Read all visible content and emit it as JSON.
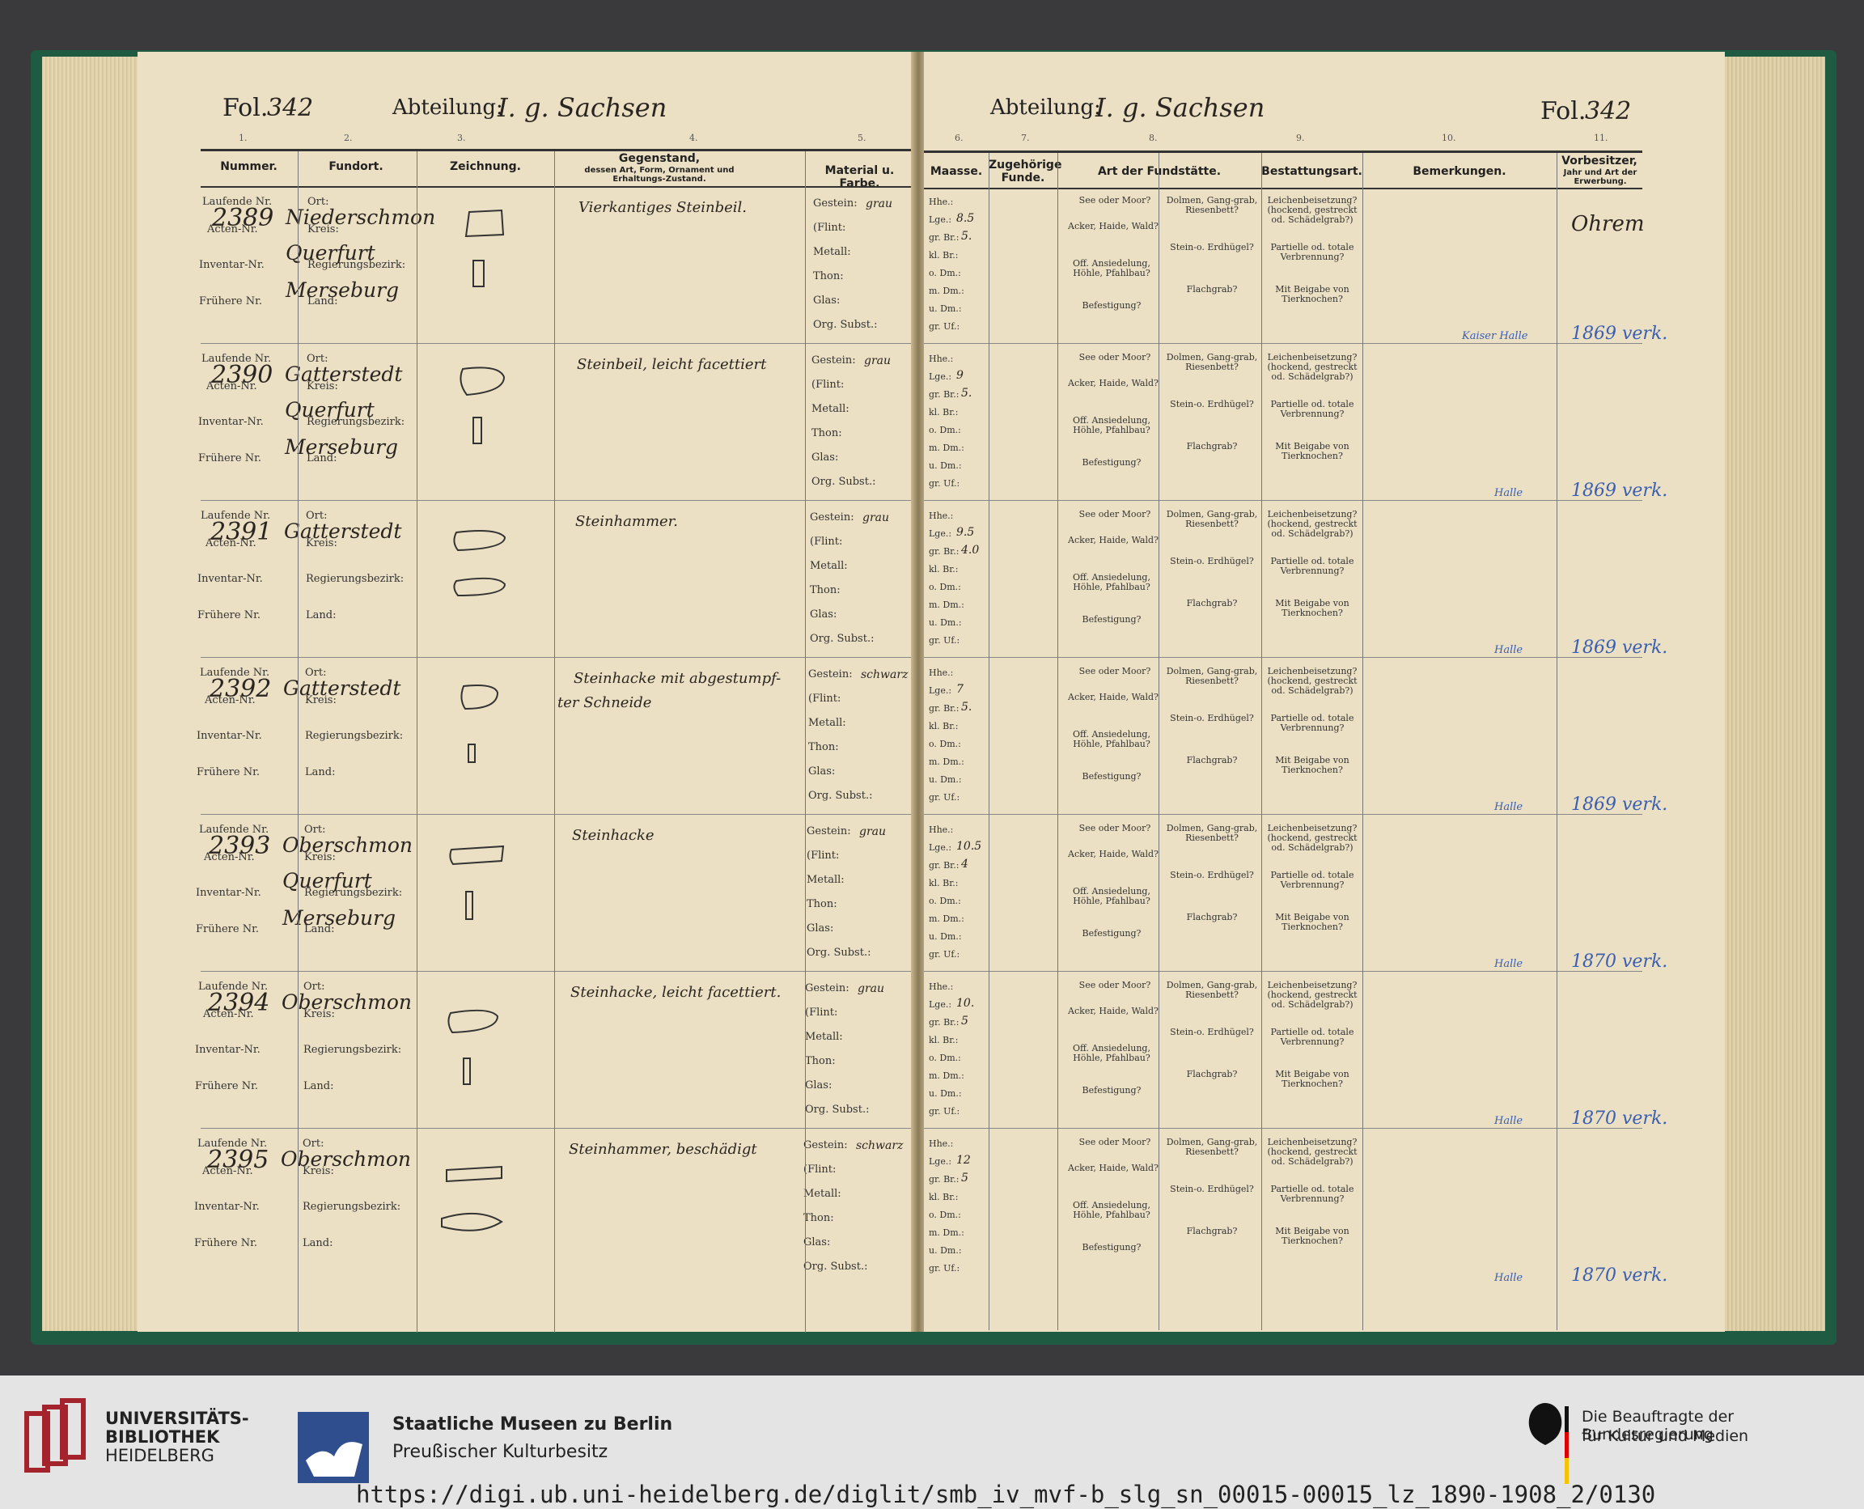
{
  "left": {
    "folio_label": "Fol.",
    "folio_num": "342",
    "abteilung_label": "Abteilung:",
    "abteilung_value": "I. g. Sachsen",
    "colnums": [
      "1.",
      "2.",
      "3.",
      "4.",
      "5."
    ],
    "headers": {
      "nummer": "Nummer.",
      "fundort": "Fundort.",
      "zeichnung": "Zeichnung.",
      "gegenstand": "Gegenstand,",
      "gegenstand_sub": "dessen Art, Form, Ornament und Erhaltungs-Zustand.",
      "material": "Material u. Farbe."
    },
    "labels": {
      "laufende": "Laufende Nr.",
      "acten": "Acten-Nr.",
      "inventar": "Inventar-Nr.",
      "fruehere": "Frühere Nr.",
      "ort": "Ort:",
      "kreis": "Kreis:",
      "bezirk": "Regierungsbezirk:",
      "land": "Land:",
      "gestein": "Gestein:",
      "flint": "(Flint:",
      "metall": "Metall:",
      "thon": "Thon:",
      "glas": "Glas:",
      "org": "Org. Subst.:"
    }
  },
  "right": {
    "abteilung_label": "Abteilung:",
    "abteilung_value": "I. g. Sachsen",
    "folio_label": "Fol.",
    "folio_num": "342",
    "colnums": [
      "6.",
      "7.",
      "8.",
      "9.",
      "10.",
      "11."
    ],
    "headers": {
      "maasse": "Maasse.",
      "zugehoerige": "Zugehörige Funde.",
      "art": "Art der Fundstätte.",
      "bestattung": "Bestattungsart.",
      "bemerkungen": "Bemerkungen.",
      "vorbesitzer": "Vorbesitzer,",
      "vorbesitzer_sub": "Jahr und Art der Erwerbung."
    },
    "maasse_labels": [
      "Hhe.:",
      "Lge.:",
      "gr. Br.:",
      "kl. Br.:",
      "o. Dm.:",
      "m. Dm.:",
      "u. Dm.:",
      "gr. Uf.:"
    ],
    "fund_texts": [
      "See oder Moor?",
      "Acker, Haide, Wald?",
      "Off. Ansiedelung, Höhle, Pfahlbau?",
      "Befestigung?",
      "Dolmen, Gang-grab, Riesenbett?",
      "Stein-o. Erdhügel?",
      "Flachgrab?"
    ],
    "best_texts": [
      "Leichenbeisetzung? (hockend, gestreckt od. Schädelgrab?)",
      "Partielle od. totale Verbrennung?",
      "Mit Beigabe von Tierknochen?"
    ]
  },
  "rows": [
    {
      "num": "2389",
      "ort": "Niederschmon",
      "kreis": "Querfurt",
      "bezirk": "Merseburg",
      "desc": "Vierkantiges Steinbeil.",
      "desc2": "",
      "gestein": "grau",
      "hhe": "",
      "lge": "8.5",
      "grbr": "5.",
      "vorbesitzer": "Ohrem",
      "bem": "Kaiser Halle",
      "year": "1869 verk."
    },
    {
      "num": "2390",
      "ort": "Gatterstedt",
      "kreis": "Querfurt",
      "bezirk": "Merseburg",
      "desc": "Steinbeil, leicht facettiert",
      "desc2": "",
      "gestein": "grau",
      "hhe": "",
      "lge": "9",
      "grbr": "5.",
      "vorbesitzer": "",
      "bem": "Halle",
      "year": "1869 verk."
    },
    {
      "num": "2391",
      "ort": "Gatterstedt",
      "kreis": "",
      "bezirk": "",
      "desc": "Steinhammer.",
      "desc2": "",
      "gestein": "grau",
      "hhe": "",
      "lge": "9.5",
      "grbr": "4.0",
      "vorbesitzer": "",
      "bem": "Halle",
      "year": "1869 verk."
    },
    {
      "num": "2392",
      "ort": "Gatterstedt",
      "kreis": "",
      "bezirk": "",
      "desc": "Steinhacke mit abgestumpf-",
      "desc2": "ter Schneide",
      "gestein": "schwarz",
      "hhe": "",
      "lge": "7",
      "grbr": "5.",
      "vorbesitzer": "",
      "bem": "Halle",
      "year": "1869 verk."
    },
    {
      "num": "2393",
      "ort": "Oberschmon",
      "kreis": "Querfurt",
      "bezirk": "Merseburg",
      "desc": "Steinhacke",
      "desc2": "",
      "gestein": "grau",
      "hhe": "",
      "lge": "10.5",
      "grbr": "4",
      "vorbesitzer": "",
      "bem": "Halle",
      "year": "1870 verk."
    },
    {
      "num": "2394",
      "ort": "Oberschmon",
      "kreis": "",
      "bezirk": "",
      "desc": "Steinhacke, leicht facettiert.",
      "desc2": "",
      "gestein": "grau",
      "hhe": "",
      "lge": "10.",
      "grbr": "5",
      "vorbesitzer": "",
      "bem": "Halle",
      "year": "1870 verk."
    },
    {
      "num": "2395",
      "ort": "Oberschmon",
      "kreis": "",
      "bezirk": "",
      "desc": "Steinhammer, beschädigt",
      "desc2": "",
      "gestein": "schwarz",
      "hhe": "",
      "lge": "12",
      "grbr": "5",
      "vorbesitzer": "",
      "bem": "Halle",
      "year": "1870 verk."
    }
  ],
  "footer": {
    "ub1": "UNIVERSITÄTS-",
    "ub2": "BIBLIOTHEK",
    "ub3": "HEIDELBERG",
    "smb1": "Staatliche Museen zu Berlin",
    "smb2": "Preußischer Kulturbesitz",
    "bkm1": "Die Beauftragte der Bundesregierung",
    "bkm2": "für Kultur und Medien",
    "url": "https://digi.ub.uni-heidelberg.de/diglit/smb_iv_mvf-b_slg_sn_00015-00015_lz_1890-1908_2/0130"
  }
}
